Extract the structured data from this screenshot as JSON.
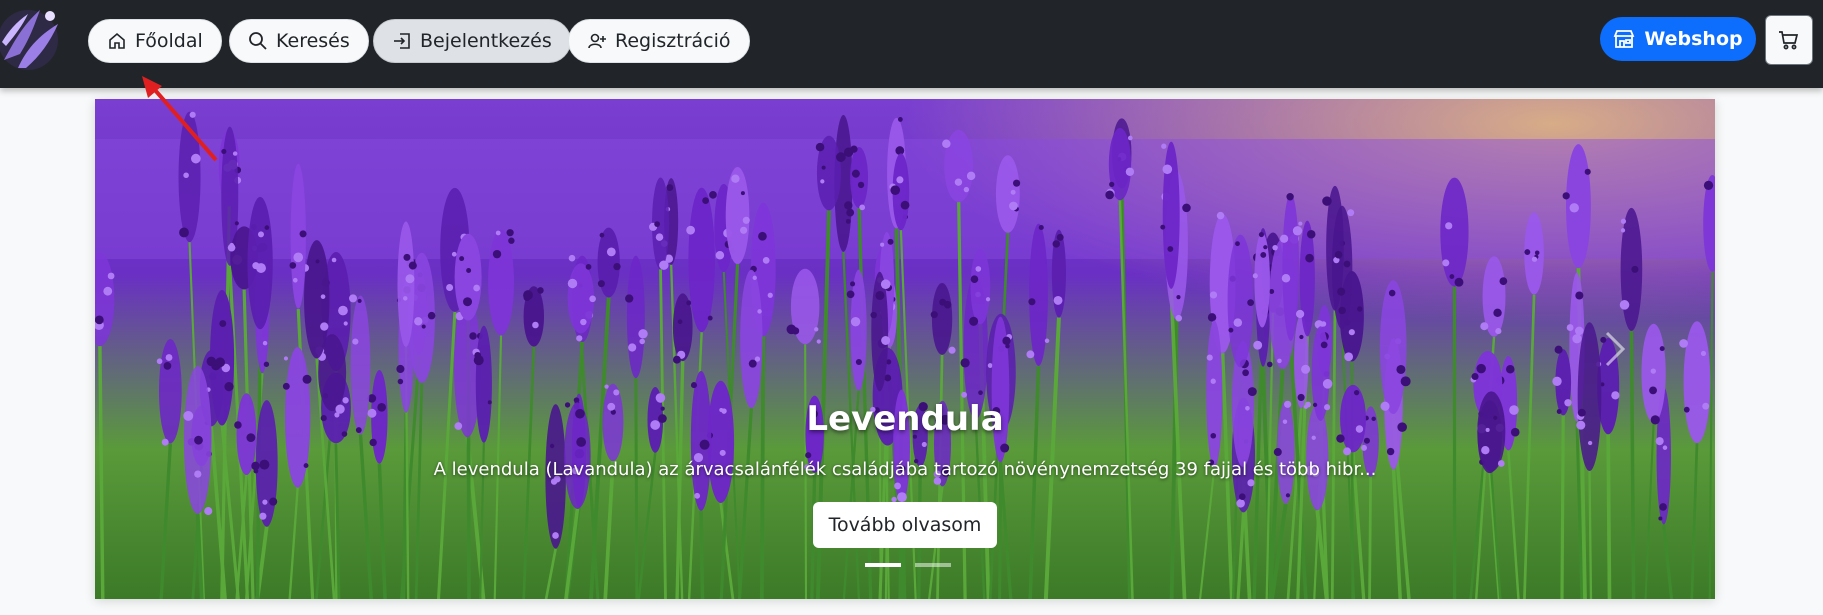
{
  "navbar": {
    "logo_icon": "lavender-logo-icon",
    "items": [
      {
        "label": "Főoldal",
        "icon": "home-icon"
      },
      {
        "label": "Keresés",
        "icon": "search-icon"
      },
      {
        "label": "Bejelentkezés",
        "icon": "login-icon"
      },
      {
        "label": "Regisztráció",
        "icon": "person-add-icon"
      }
    ],
    "webshop_label": "Webshop",
    "webshop_icon": "shop-icon",
    "cart_icon": "cart-icon"
  },
  "carousel": {
    "title": "Levendula",
    "description": "A levendula (Lavandula) az árvacsalánfélék családjába tartozó növénynemzetség 39 fajjal és több hibr...",
    "button_label": "Tovább olvasom",
    "slide_count": 2,
    "active_slide": 1
  },
  "colors": {
    "navbar_bg": "#212529",
    "webshop_bg": "#0d6efd",
    "annotation_arrow": "#e02020"
  }
}
